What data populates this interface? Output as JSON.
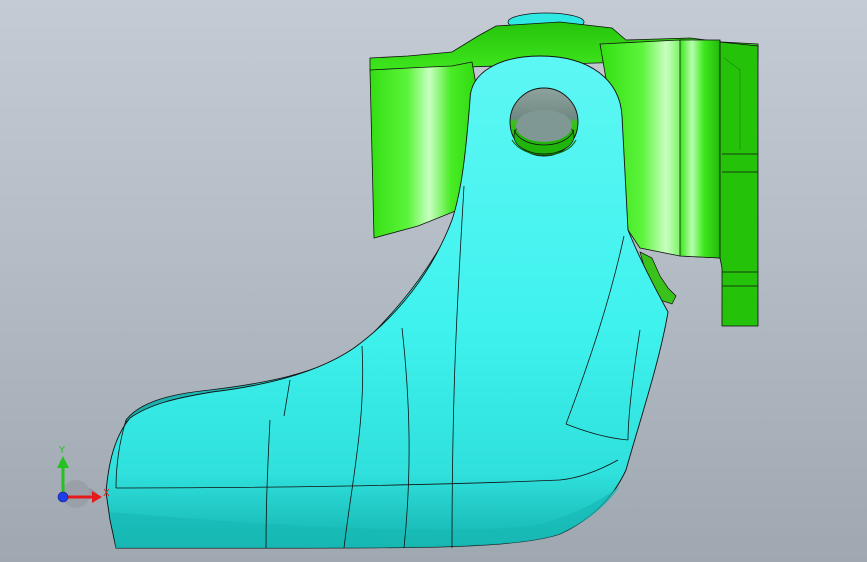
{
  "triad": {
    "y_label": "Y",
    "x_label": "X"
  },
  "colors": {
    "background_top": "#c4cbd4",
    "background_bottom": "#9fa7b1",
    "part_cyan": "#3ff2ee",
    "part_cyan_dark": "#0fa7a3",
    "part_green": "#3de81e",
    "part_green_dark": "#16a209",
    "edge_line": "#111111",
    "axis_x": "#e51b1b",
    "axis_y": "#26c21f",
    "axis_z": "#1f3fe6"
  }
}
